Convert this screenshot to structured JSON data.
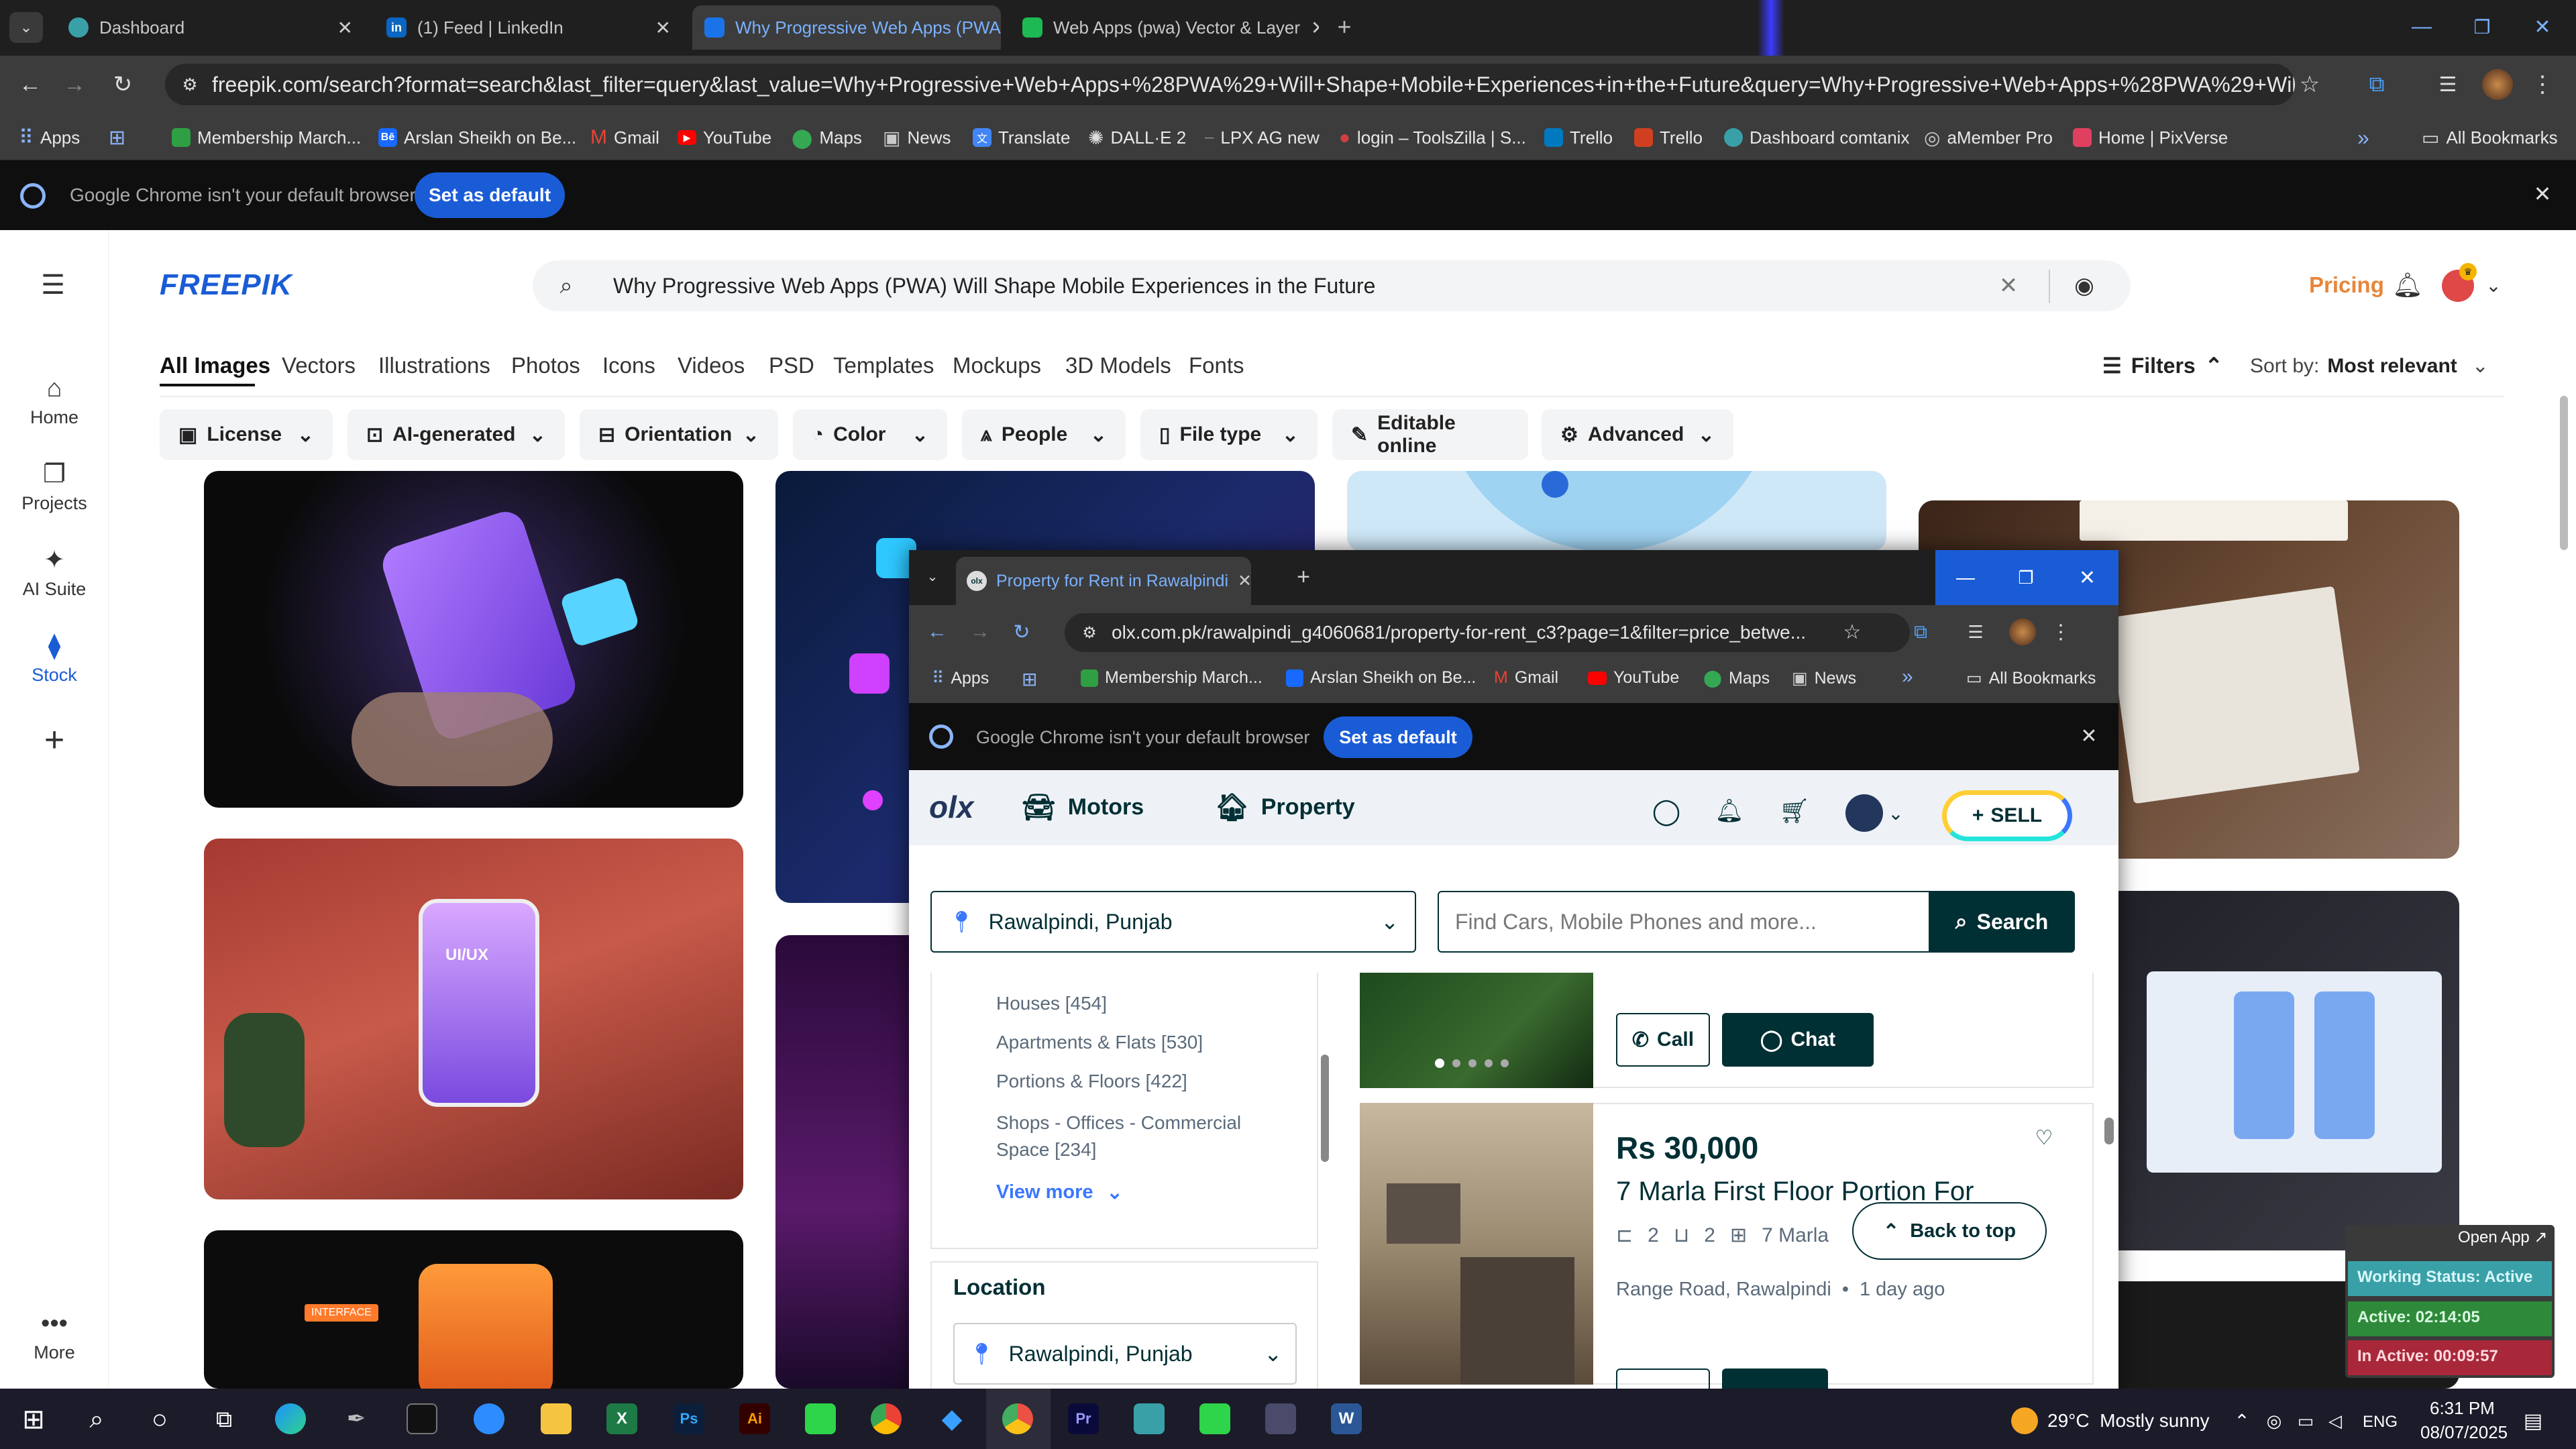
{
  "browser": {
    "tabs": [
      {
        "title": "Dashboard",
        "color": "#3aa0a8"
      },
      {
        "title": "(1) Feed | LinkedIn",
        "color": "#0a66c2"
      },
      {
        "title": "Why Progressive Web Apps (PWA)",
        "color": "#1a73e8"
      },
      {
        "title": "Web Apps (pwa) Vector & Layer",
        "color": "#1db954"
      }
    ],
    "url": "freepik.com/search?format=search&last_filter=query&last_value=Why+Progressive+Web+Apps+%28PWA%29+Will+Shape+Mobile+Experiences+in+the+Future&query=Why+Progressive+Web+Apps+%28PWA%29+Will+Shape+Mobile+Experien...",
    "bookmarks": [
      {
        "label": "Apps",
        "color": "#8ab4f8"
      },
      {
        "label": "Membership March...",
        "color": "#2ea043"
      },
      {
        "label": "Arslan Sheikh on Be...",
        "color": "#1769ff"
      },
      {
        "label": "Gmail",
        "color": "#ea4335"
      },
      {
        "label": "YouTube",
        "color": "#ff0000"
      },
      {
        "label": "Maps",
        "color": "#34a853"
      },
      {
        "label": "News",
        "color": "#c8c8c8"
      },
      {
        "label": "Translate",
        "color": "#4285f4"
      },
      {
        "label": "DALL·E 2",
        "color": "#dddddd"
      },
      {
        "label": "LPX AG new",
        "color": "#888888"
      },
      {
        "label": "login – ToolsZilla | S...",
        "color": "#d04040"
      },
      {
        "label": "Trello",
        "color": "#0079bf"
      },
      {
        "label": "Trello",
        "color": "#d04020"
      },
      {
        "label": "Dashboard comtanix",
        "color": "#3aa0a8"
      },
      {
        "label": "aMember Pro",
        "color": "#cccccc"
      },
      {
        "label": "Home | PixVerse",
        "color": "#e04060"
      }
    ],
    "all_bookmarks": "All Bookmarks",
    "default_notice": "Google Chrome isn't your default browser",
    "set_default": "Set as default"
  },
  "freepik": {
    "logo": "FREEPIK",
    "search_query": "Why Progressive Web Apps (PWA) Will Shape Mobile Experiences in the Future",
    "pricing": "Pricing",
    "sidebar": [
      {
        "label": "Home",
        "icon": "home-icon"
      },
      {
        "label": "Projects",
        "icon": "folder-icon"
      },
      {
        "label": "AI Suite",
        "icon": "sparkle-icon"
      },
      {
        "label": "Stock",
        "icon": "stock-icon"
      },
      {
        "label": "More",
        "icon": "dots-icon"
      }
    ],
    "categories": [
      "All Images",
      "Vectors",
      "Illustrations",
      "Photos",
      "Icons",
      "Videos",
      "PSD",
      "Templates",
      "Mockups",
      "3D Models",
      "Fonts"
    ],
    "filters_label": "Filters",
    "sort_label": "Sort by:",
    "sort_value": "Most relevant",
    "filters": [
      "License",
      "AI-generated",
      "Orientation",
      "Color",
      "People",
      "File type",
      "Editable online",
      "Advanced"
    ],
    "card_text": [
      "UI/UX",
      "INTERFACE"
    ]
  },
  "olx": {
    "tab_title": "Property for Rent in Rawalpindi",
    "url": "olx.com.pk/rawalpindi_g4060681/property-for-rent_c3?page=1&filter=price_betwe...",
    "bookmarks": [
      "Apps",
      "Membership March...",
      "Arslan Sheikh on Be...",
      "Gmail",
      "YouTube",
      "Maps",
      "News"
    ],
    "all_bookmarks": "All Bookmarks",
    "default_notice": "Google Chrome isn't your default browser",
    "set_default": "Set as default",
    "nav": [
      "Motors",
      "Property"
    ],
    "sell": "SELL",
    "location": "Rawalpindi, Punjab",
    "search_placeholder": "Find Cars, Mobile Phones and more...",
    "search_button": "Search",
    "categories": [
      "Houses [454]",
      "Apartments & Flats [530]",
      "Portions & Floors [422]",
      "Shops - Offices - Commercial Space [234]"
    ],
    "view_more": "View more",
    "location_heading": "Location",
    "location_select": "Rawalpindi, Punjab",
    "call": "Call",
    "chat": "Chat",
    "listing": {
      "price": "Rs 30,000",
      "title": "7 Marla First Floor Portion For",
      "beds": "2",
      "baths": "2",
      "area": "7 Marla",
      "place": "Range Road, Rawalpindi",
      "age": "1 day ago"
    },
    "back_to_top": "Back to top"
  },
  "tracker": {
    "open_app": "Open App ↗",
    "working": "Working Status: Active",
    "active": "Active: 02:14:05",
    "inactive": "In Active: 00:09:57"
  },
  "taskbar": {
    "weather": "29°C  Mostly sunny",
    "lang": "ENG",
    "time": "6:31 PM",
    "date": "08/07/2025"
  }
}
